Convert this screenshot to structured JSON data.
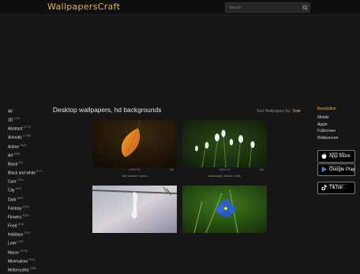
{
  "header": {
    "logo": "WallpapersCraft",
    "search_placeholder": "Search"
  },
  "sidebar": {
    "items": [
      {
        "label": "All",
        "count": ""
      },
      {
        "label": "3D",
        "count": "1754"
      },
      {
        "label": "Abstract",
        "count": "11778"
      },
      {
        "label": "Animals",
        "count": "17256"
      },
      {
        "label": "Anime",
        "count": "3549"
      },
      {
        "label": "Art",
        "count": "5059"
      },
      {
        "label": "Black",
        "count": "514"
      },
      {
        "label": "Black and white",
        "count": "3771"
      },
      {
        "label": "Cars",
        "count": "7336"
      },
      {
        "label": "City",
        "count": "4891"
      },
      {
        "label": "Dark",
        "count": "6587"
      },
      {
        "label": "Fantasy",
        "count": "9055"
      },
      {
        "label": "Flowers",
        "count": "6049"
      },
      {
        "label": "Food",
        "count": "3058"
      },
      {
        "label": "Holidays",
        "count": "2193"
      },
      {
        "label": "Love",
        "count": "1497"
      },
      {
        "label": "Macro",
        "count": "14758"
      },
      {
        "label": "Minimalism",
        "count": "3238"
      },
      {
        "label": "Motorcycles",
        "count": "1385"
      }
    ]
  },
  "main": {
    "title": "Desktop wallpapers, hd backgrounds",
    "sort_label": "Sort Wallpapers by:",
    "sort_value": "Date"
  },
  "resolution": {
    "heading": "Resolution",
    "links": [
      "Mobile",
      "Apple",
      "Fullscreen",
      "Widescreen"
    ]
  },
  "badges": [
    {
      "small": "Available on the",
      "big": "App Store",
      "icon": "apple-icon"
    },
    {
      "small": "GET IT ON",
      "big": "Google Play",
      "icon": "play-icon"
    },
    {
      "small": "Welcome to our",
      "big": "TikTok",
      "icon": "tiktok-icon"
    }
  ],
  "wallpapers": [
    {
      "resolution": "1280x720",
      "rating": "134",
      "caption": "leaf, autumn, macro"
    },
    {
      "resolution": "1280x720",
      "rating": "102",
      "caption": "snowdrops, flowers, buds"
    },
    {
      "resolution": "",
      "rating": "",
      "caption": ""
    },
    {
      "resolution": "",
      "rating": "",
      "caption": ""
    }
  ],
  "colors": {
    "accent": "#e8b64a",
    "background": "#161616"
  }
}
